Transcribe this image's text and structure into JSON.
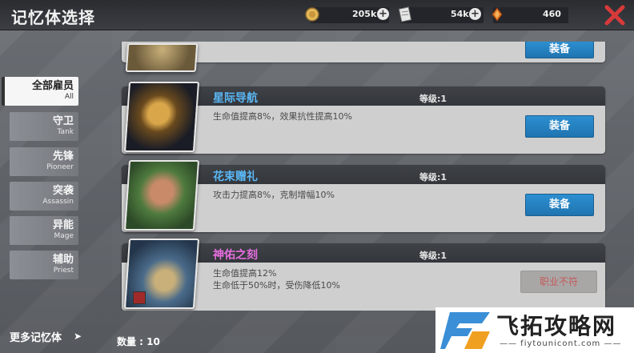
{
  "header": {
    "title": "记忆体选择",
    "resources": [
      {
        "icon": "coin-icon",
        "value": "205k"
      },
      {
        "icon": "ticket-icon",
        "value": "54k"
      },
      {
        "icon": "crystal-icon",
        "value": "460"
      }
    ]
  },
  "nav": {
    "items": [
      {
        "cn": "全部雇员",
        "en": "All"
      },
      {
        "cn": "守卫",
        "en": "Tank"
      },
      {
        "cn": "先锋",
        "en": "Pioneer"
      },
      {
        "cn": "突袭",
        "en": "Assassin"
      },
      {
        "cn": "异能",
        "en": "Mage"
      },
      {
        "cn": "辅助",
        "en": "Priest"
      }
    ],
    "more_label": "更多记忆体"
  },
  "list": {
    "count_label": "数量 : 10",
    "first_button": "装备",
    "cards": [
      {
        "name": "星际导航",
        "level": "等级:1",
        "desc": [
          "生命值提高8%，效果抗性提高10%"
        ],
        "button": "装备",
        "name_color": "#5ab7f5"
      },
      {
        "name": "花束赠礼",
        "level": "等级:1",
        "desc": [
          "攻击力提高8%，克制增幅10%"
        ],
        "button": "装备",
        "name_color": "#5ab7f5"
      },
      {
        "name": "神佑之刻",
        "level": "等级:1",
        "desc": [
          "生命值提高12%",
          "生命低于50%时，受伤降低10%"
        ],
        "button": "职业不符",
        "name_color": "#e86fe0"
      }
    ]
  },
  "watermark": {
    "title": "飞拓攻略网",
    "sub": "—— fiytounicont.com ——"
  },
  "colors": {
    "accent": "#2d8fd1",
    "close": "#d83a3a"
  }
}
